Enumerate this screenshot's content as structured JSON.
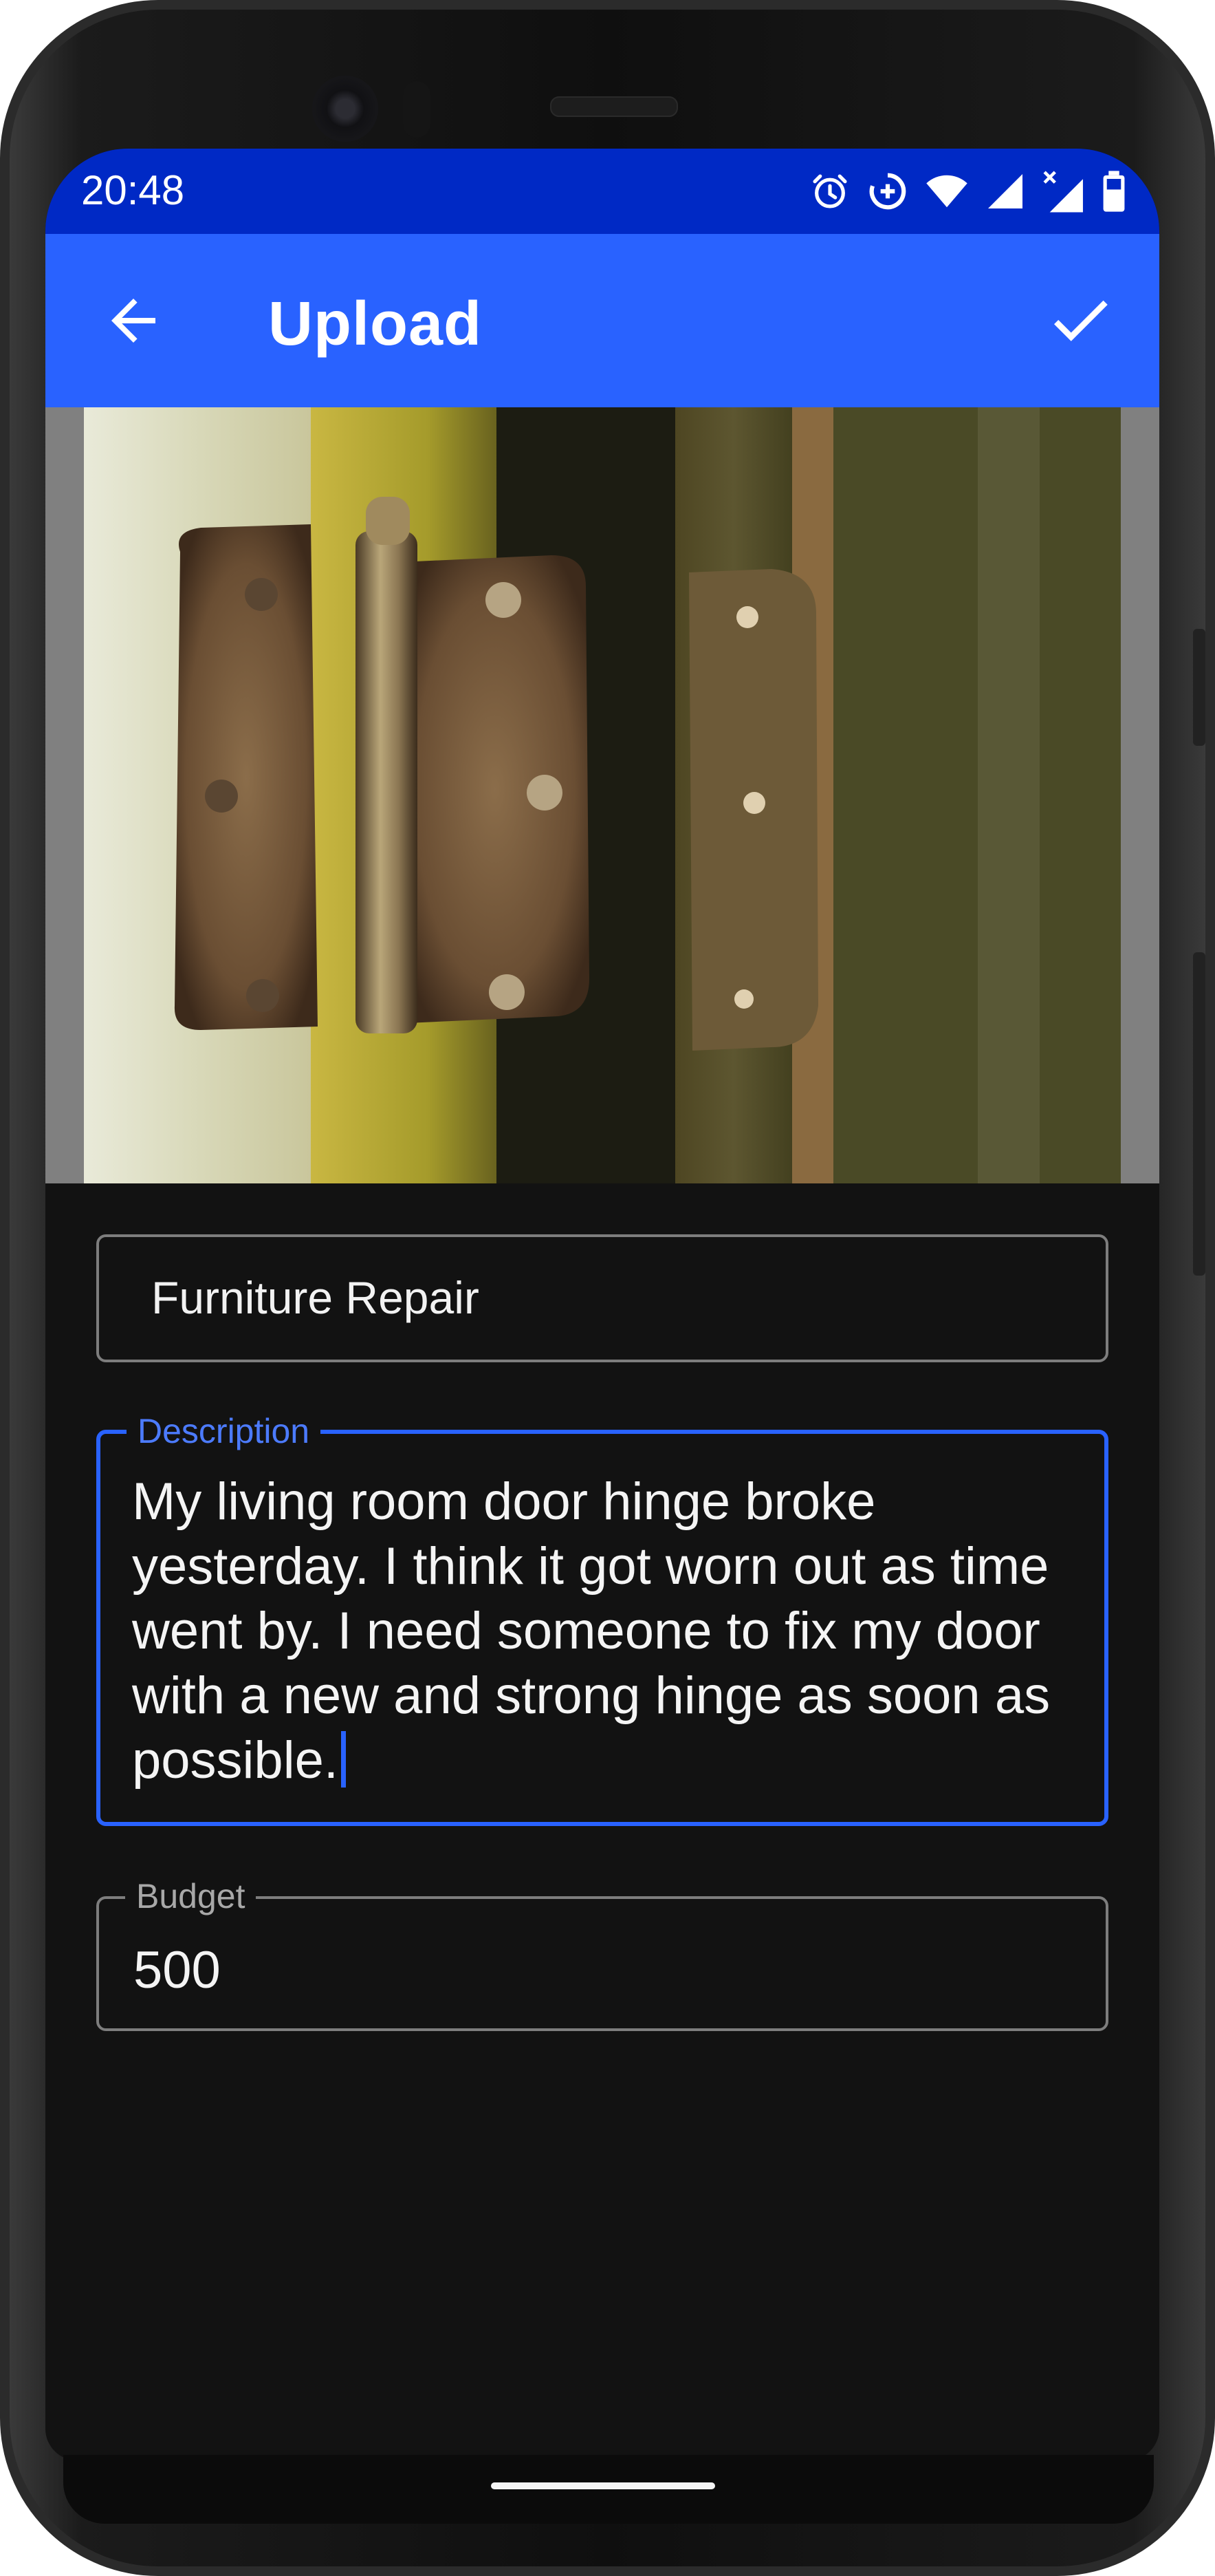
{
  "status_bar": {
    "time": "20:48",
    "icons": [
      "alarm-icon",
      "data-saver-icon",
      "wifi-icon",
      "signal-icon",
      "signal-no-service-icon",
      "battery-icon"
    ]
  },
  "app_bar": {
    "title": "Upload",
    "back_icon": "arrow-back-icon",
    "confirm_icon": "check-icon",
    "color": "#2962ff",
    "status_color": "#0029c5"
  },
  "photo": {
    "subject": "door-hinge-photo"
  },
  "form": {
    "name": {
      "value": "Furniture Repair"
    },
    "description": {
      "label": "Description",
      "value": "My living room door hinge broke yesterday. I think it got worn out as time went by. I need someone to fix my door with a new and strong hinge as soon as possible."
    },
    "budget": {
      "label": "Budget",
      "value": "500"
    }
  },
  "colors": {
    "background": "#121212",
    "accent": "#2962ff",
    "text": "#f4f4f4"
  }
}
